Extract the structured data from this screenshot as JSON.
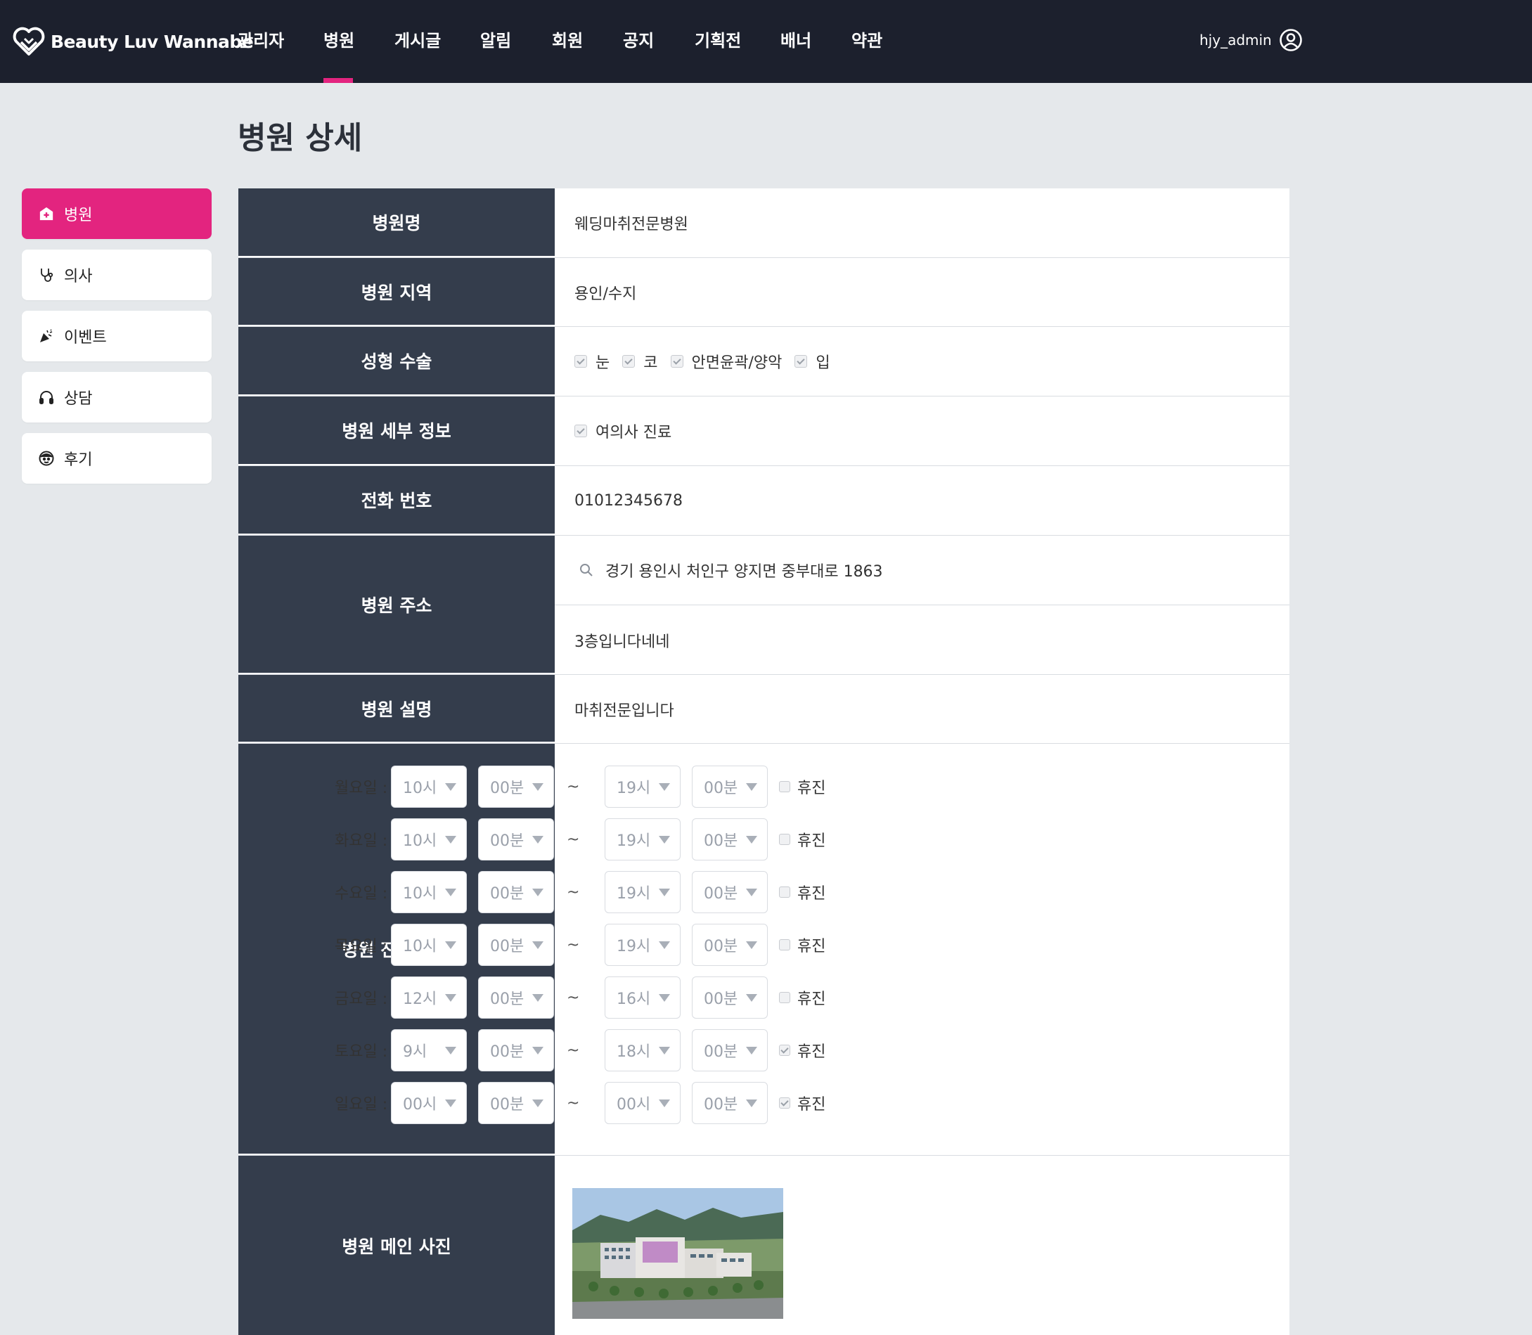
{
  "brand": {
    "name": "Beauty Luv Wannabe"
  },
  "nav": {
    "items": [
      "관리자",
      "병원",
      "게시글",
      "알림",
      "회원",
      "공지",
      "기획전",
      "배너",
      "약관"
    ],
    "active": "병원",
    "accent": "#e3247f"
  },
  "user": {
    "name": "hjy_admin",
    "icon": "user-circle-icon"
  },
  "page": {
    "title": "병원 상세"
  },
  "sidebar": {
    "items": [
      {
        "label": "병원",
        "icon": "hospital-icon",
        "active": true
      },
      {
        "label": "의사",
        "icon": "stethoscope-icon",
        "active": false
      },
      {
        "label": "이벤트",
        "icon": "party-popper-icon",
        "active": false
      },
      {
        "label": "상담",
        "icon": "headset-icon",
        "active": false
      },
      {
        "label": "후기",
        "icon": "face-icon",
        "active": false
      }
    ]
  },
  "detail": {
    "labels": {
      "name": "병원명",
      "region": "병원 지역",
      "surgery": "성형 수술",
      "info": "병원 세부 정보",
      "phone": "전화 번호",
      "address": "병원 주소",
      "description": "병원 설명",
      "hours": "병원 진료 시간",
      "photo": "병원 메인 사진"
    },
    "name": "웨딩마취전문병원",
    "region": "용인/수지",
    "surgery": [
      {
        "label": "눈",
        "checked": true
      },
      {
        "label": "코",
        "checked": true
      },
      {
        "label": "안면윤곽/양악",
        "checked": true
      },
      {
        "label": "입",
        "checked": true
      }
    ],
    "info": [
      {
        "label": "여의사 진료",
        "checked": true
      }
    ],
    "phone": "01012345678",
    "address": {
      "main": "경기 용인시 처인구 양지면 중부대로 1863",
      "detail": "3층입니다네네"
    },
    "description": "마취전문입니다",
    "hours": [
      {
        "day": "월요일 :",
        "open_h": "10시",
        "open_m": "00분",
        "close_h": "19시",
        "close_m": "00분",
        "holiday": false
      },
      {
        "day": "화요일 :",
        "open_h": "10시",
        "open_m": "00분",
        "close_h": "19시",
        "close_m": "00분",
        "holiday": false
      },
      {
        "day": "수요일 :",
        "open_h": "10시",
        "open_m": "00분",
        "close_h": "19시",
        "close_m": "00분",
        "holiday": false
      },
      {
        "day": "목요일 :",
        "open_h": "10시",
        "open_m": "00분",
        "close_h": "19시",
        "close_m": "00분",
        "holiday": false
      },
      {
        "day": "금요일 :",
        "open_h": "12시",
        "open_m": "00분",
        "close_h": "16시",
        "close_m": "00분",
        "holiday": false
      },
      {
        "day": "토요일 :",
        "open_h": "9시",
        "open_m": "00분",
        "close_h": "18시",
        "close_m": "00분",
        "holiday": true
      },
      {
        "day": "일요일 :",
        "open_h": "00시",
        "open_m": "00분",
        "close_h": "00시",
        "close_m": "00분",
        "holiday": true
      }
    ],
    "tilde": "~",
    "holiday_label": "휴진"
  }
}
